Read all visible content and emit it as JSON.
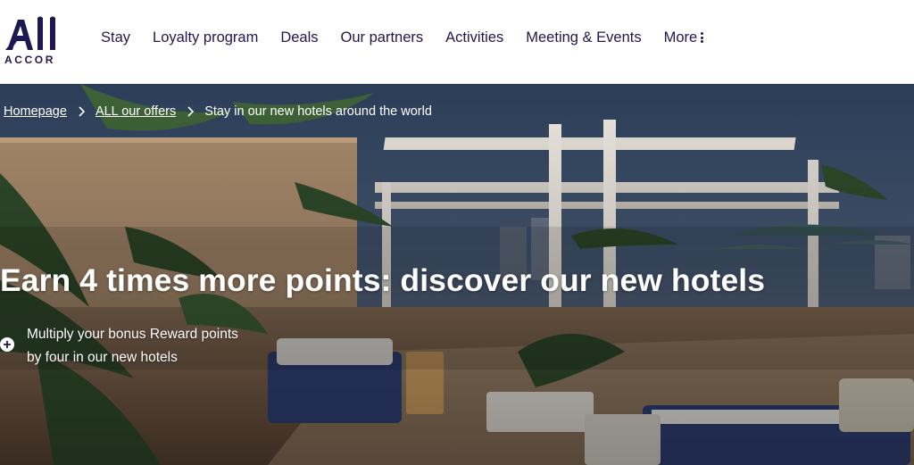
{
  "brand": {
    "logo_top": "All",
    "logo_word": "ACCOR",
    "color": "#1e1852"
  },
  "nav": {
    "items": [
      {
        "label": "Stay"
      },
      {
        "label": "Loyalty program"
      },
      {
        "label": "Deals"
      },
      {
        "label": "Our partners"
      },
      {
        "label": "Activities"
      },
      {
        "label": "Meeting & Events"
      }
    ],
    "more_label": "More"
  },
  "breadcrumb": {
    "home": "Homepage",
    "offers": "ALL our offers",
    "current": "Stay in our new hotels around the world"
  },
  "hero": {
    "title": "Earn 4 times more points: discover our new hotels",
    "bullet": "Multiply your bonus Reward points by four in our new hotels"
  }
}
